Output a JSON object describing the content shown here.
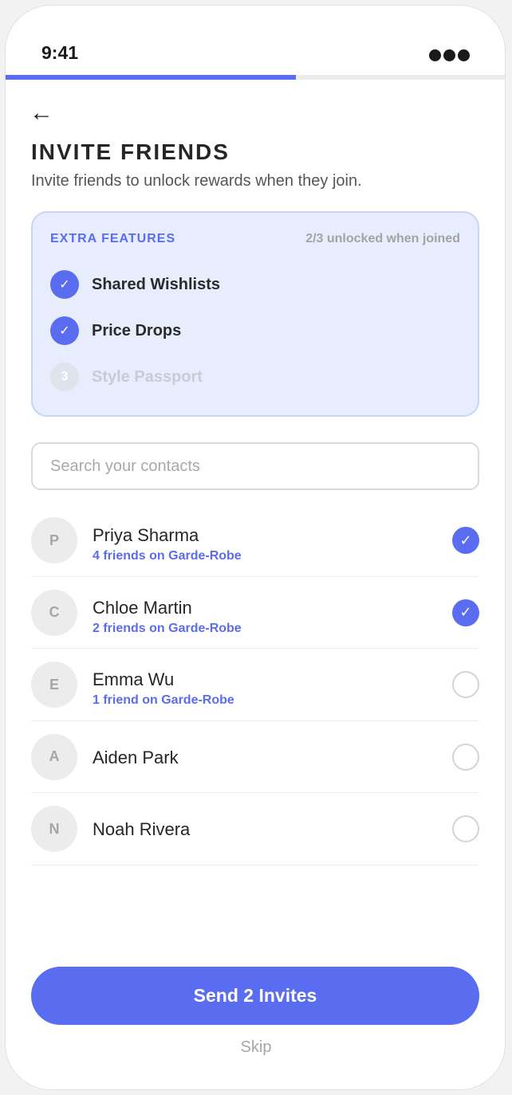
{
  "status_bar": {
    "time": "9:41",
    "signal_icon": "more-dots-icon"
  },
  "progress": {
    "fraction": 0.58,
    "color": "#5a6cf0"
  },
  "header": {
    "back_icon": "back-arrow-icon",
    "back_glyph": "←",
    "title": "INVITE FRIENDS",
    "subtitle": "Invite friends to unlock rewards when they join."
  },
  "features": {
    "label": "EXTRA FEATURES",
    "count_text": "2/3 unlocked when joined",
    "items": [
      {
        "name": "Shared Wishlists",
        "state": "unlocked",
        "badge": "✓"
      },
      {
        "name": "Price Drops",
        "state": "unlocked",
        "badge": "✓"
      },
      {
        "name": "Style Passport",
        "state": "locked",
        "badge": "3"
      }
    ]
  },
  "search": {
    "placeholder": "Search your contacts",
    "value": ""
  },
  "contacts": [
    {
      "initial": "P",
      "name": "Priya Sharma",
      "mutual": "4 friends on Garde-Robe",
      "selected": true,
      "check": "✓"
    },
    {
      "initial": "C",
      "name": "Chloe Martin",
      "mutual": "2 friends on Garde-Robe",
      "selected": true,
      "check": "✓"
    },
    {
      "initial": "E",
      "name": "Emma Wu",
      "mutual": "1 friend on Garde-Robe",
      "selected": false,
      "check": ""
    },
    {
      "initial": "A",
      "name": "Aiden Park",
      "mutual": "",
      "selected": false,
      "check": ""
    },
    {
      "initial": "N",
      "name": "Noah Rivera",
      "mutual": "",
      "selected": false,
      "check": ""
    }
  ],
  "actions": {
    "send_label": "Send 2 Invites",
    "skip_label": "Skip"
  },
  "colors": {
    "accent": "#5a6cf0",
    "card_bg": "#e7edfd"
  }
}
